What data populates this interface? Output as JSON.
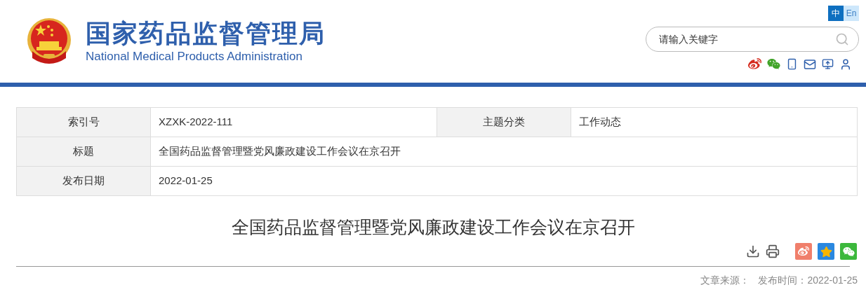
{
  "header": {
    "name_zh": "国家药品监督管理局",
    "name_en": "National Medical Products Administration",
    "languages": [
      {
        "label": "中",
        "selected": true
      },
      {
        "label": "En",
        "selected": false
      }
    ],
    "search": {
      "placeholder": "请输入关键字"
    }
  },
  "info_table": {
    "rows": [
      {
        "cells": [
          {
            "label": "索引号",
            "value": "XZXK-2022-111"
          },
          {
            "label": "主题分类",
            "value": "工作动态"
          }
        ]
      },
      {
        "cells": [
          {
            "label": "标题",
            "value": "全国药品监督管理暨党风廉政建设工作会议在京召开"
          }
        ]
      },
      {
        "cells": [
          {
            "label": "发布日期",
            "value": "2022-01-25"
          }
        ]
      }
    ]
  },
  "article": {
    "title": "全国药品监督管理暨党风廉政建设工作会议在京召开",
    "meta": [
      "文章来源：",
      "发布时间：2022-01-25"
    ]
  }
}
